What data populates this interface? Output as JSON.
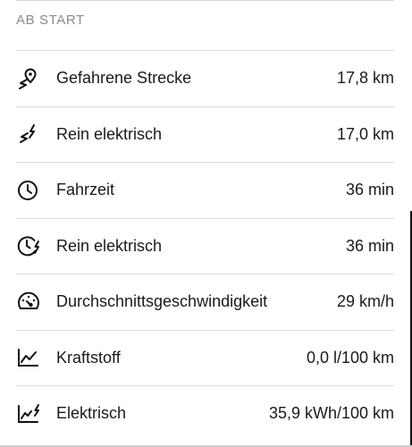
{
  "section": {
    "title": "AB START"
  },
  "rows": [
    {
      "icon": "route-pin-icon",
      "label": "Gefahrene Strecke",
      "value": "17,8 km"
    },
    {
      "icon": "electric-route-icon",
      "label": "Rein elektrisch",
      "value": "17,0 km"
    },
    {
      "icon": "clock-icon",
      "label": "Fahrzeit",
      "value": "36 min"
    },
    {
      "icon": "electric-clock-icon",
      "label": "Rein elektrisch",
      "value": "36 min"
    },
    {
      "icon": "speedometer-icon",
      "label": "Durchschnittsgeschwindigkeit",
      "value": "29 km/h"
    },
    {
      "icon": "fuel-trend-icon",
      "label": "Kraftstoff",
      "value": "0,0 l/100 km"
    },
    {
      "icon": "electric-trend-icon",
      "label": "Elektrisch",
      "value": "35,9 kWh/100 km"
    }
  ],
  "colors": {
    "text": "#1a1a1a",
    "muted": "#8a8a8a",
    "divider": "#dcdcdc"
  }
}
